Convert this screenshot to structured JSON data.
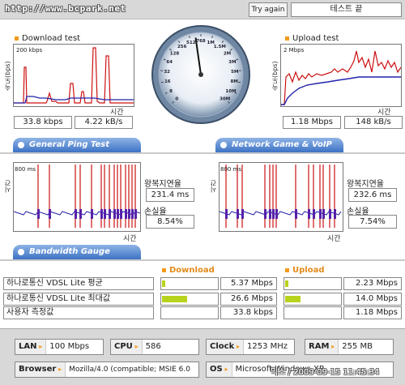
{
  "header": {
    "site_url": "http://www.bcpark.net",
    "try_again_label": "Try again",
    "status": "테스트 끝"
  },
  "download": {
    "title": "Download test",
    "ylabel": "속도(bps)",
    "scale": "200 kbps",
    "xlabel": "시간",
    "value_bps": "33.8 kbps",
    "value_Bps": "4.22 kB/s"
  },
  "upload": {
    "title": "Upload test",
    "ylabel": "속도(bps)",
    "scale": "2 Mbps",
    "xlabel": "시간",
    "value_bps": "1.18 Mbps",
    "value_Bps": "148 kB/s"
  },
  "gauge": {
    "labels": [
      "0",
      "8",
      "16",
      "32",
      "64",
      "128",
      "256",
      "512",
      "768",
      "1M",
      "1.5M",
      "2M",
      "3M",
      "5M",
      "8M",
      "10M",
      "30M"
    ],
    "needle_value_fraction": 0.47
  },
  "sections": {
    "ping": "General Ping Test",
    "game": "Network Game & VoIP Test",
    "bandwidth": "Bandwidth Gauge"
  },
  "ping_left": {
    "ylabel": "시간(ms)",
    "scale": "800 ms",
    "xlabel": "시간",
    "rtt_label": "왕복지연율",
    "rtt_value": "231.4 ms",
    "loss_label": "손실율",
    "loss_value": "8.54%"
  },
  "ping_right": {
    "ylabel": "시간(ms)",
    "scale": "800 ms",
    "xlabel": "시간",
    "rtt_label": "왕복지연율",
    "rtt_value": "232.6 ms",
    "loss_label": "손실율",
    "loss_value": "7.54%"
  },
  "bandwidth": {
    "download_header": "Download",
    "upload_header": "Upload",
    "rows": [
      {
        "name": "하나로통신 VDSL Lite 평균",
        "download": "5.37 Mbps",
        "download_fill": 0.06,
        "upload": "2.23 Mbps",
        "upload_fill": 0.05
      },
      {
        "name": "하나로통신 VDSL Lite 최대값",
        "download": "26.6 Mbps",
        "download_fill": 0.44,
        "upload": "14.0 Mbps",
        "upload_fill": 0.27
      },
      {
        "name": "사용자 측정값",
        "download": "33.8 kbps",
        "download_fill": 0.0,
        "upload": "1.18 Mbps",
        "upload_fill": 0.0
      }
    ]
  },
  "system": {
    "lan_label": "LAN",
    "lan_value": "100 Mbps",
    "cpu_label": "CPU",
    "cpu_value": "586",
    "clock_label": "Clock",
    "clock_value": "1253 MHz",
    "ram_label": "RAM",
    "ram_value": "255 MB",
    "browser_label": "Browser",
    "browser_value": "Mozilla/4.0 (compatible; MSIE 6.0",
    "os_label": "OS",
    "os_value": "Microsoft Windows XP"
  },
  "credit": "익스 / 2009-09-15 11:45:34",
  "colors": {
    "accent": "#f39a1e",
    "trace_red": "#cc1111",
    "trace_blue": "#2222aa",
    "section_blue": "#3d72c4",
    "bar_green": "#b9d31c"
  }
}
